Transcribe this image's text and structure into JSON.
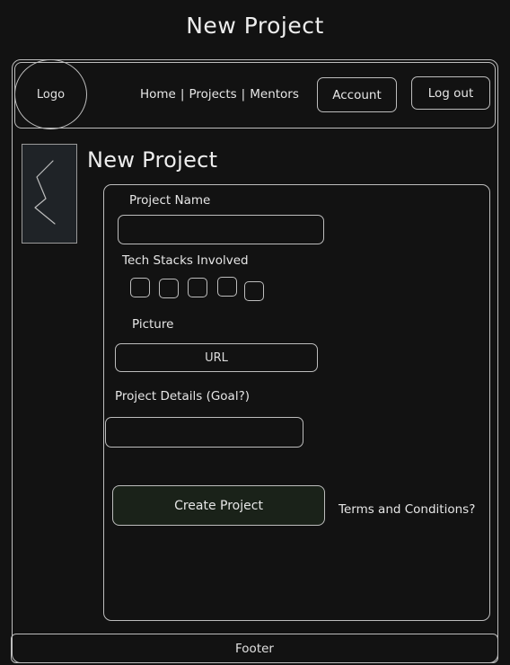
{
  "page": {
    "title": "New Project"
  },
  "header": {
    "logo": "Logo",
    "nav": {
      "home": "Home",
      "separator": "|",
      "projects": "Projects",
      "mentors": "Mentors"
    },
    "account_label": "Account",
    "logout_label": "Log out"
  },
  "main": {
    "title": "New Project",
    "form": {
      "project_name_label": "Project Name",
      "project_name_value": "",
      "tech_stacks_label": "Tech Stacks Involved",
      "tech_stack_checkbox_count": 5,
      "picture_label": "Picture",
      "picture_placeholder": "URL",
      "details_label": "Project Details (Goal?)",
      "details_value": "",
      "create_label": "Create Project",
      "terms_label": "Terms and Conditions?"
    }
  },
  "footer": {
    "label": "Footer"
  },
  "colors": {
    "background": "#121212",
    "stroke": "#bdbdbd",
    "create_button_fill": "#1a2219"
  }
}
